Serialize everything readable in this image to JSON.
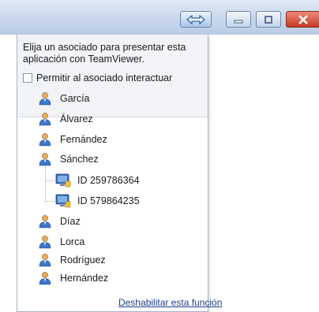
{
  "panel": {
    "description": "Elija un asociado para presentar esta aplicación con TeamViewer.",
    "allow_interaction_label": "Permitir al asociado interactuar",
    "disable_link": "Deshabilitar esta función"
  },
  "partners": [
    {
      "name": "García"
    },
    {
      "name": "Álvarez"
    },
    {
      "name": "Fernández"
    },
    {
      "name": "Sánchez",
      "devices": [
        {
          "label": "ID 259786364"
        },
        {
          "label": "ID 579864235"
        }
      ]
    },
    {
      "name": "Díaz"
    },
    {
      "name": "Lorca"
    },
    {
      "name": "Rodríguez"
    },
    {
      "name": "Hernández"
    }
  ],
  "colors": {
    "accent": "#1f3f8a",
    "close": "#c53a24",
    "titlebar": "#c8d7eb"
  },
  "icons": {
    "share": "share-arrows-icon",
    "minimize": "minimize-icon",
    "maximize": "maximize-icon",
    "close": "close-icon",
    "person": "person-icon",
    "computer": "computer-icon"
  }
}
